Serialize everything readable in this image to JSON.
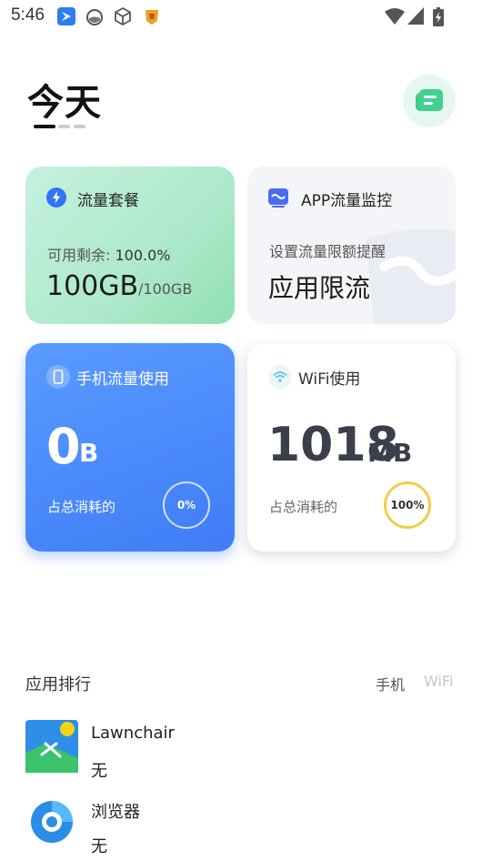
{
  "status_bar": {
    "time": "5:46"
  },
  "header": {
    "title": "今天"
  },
  "cards": {
    "data_plan": {
      "label": "流量套餐",
      "remaining_label": "可用剩余:",
      "remaining_value": "100.0%",
      "amount": "100GB",
      "total": "/100GB"
    },
    "app_monitor": {
      "label": "APP流量监控",
      "subtitle": "设置流量限额提醒",
      "action": "应用限流"
    },
    "mobile_usage": {
      "label": "手机流量使用",
      "amount_value": "0",
      "amount_unit": "B",
      "share_label": "占总消耗的",
      "share_percent": "0%"
    },
    "wifi_usage": {
      "label": "WiFi使用",
      "amount_value": "1018",
      "amount_unit": "MB",
      "share_label": "占总消耗的",
      "share_percent": "100%"
    }
  },
  "ranking": {
    "title": "应用排行",
    "tabs": [
      "手机",
      "WiFi"
    ],
    "active_tab": "手机",
    "apps": [
      {
        "name": "Lawnchair",
        "usage": "无",
        "icon": "lawnchair-icon"
      },
      {
        "name": "浏览器",
        "usage": "无",
        "icon": "browser-icon"
      }
    ]
  },
  "colors": {
    "green_card": "#aee9ca",
    "blue_card": "#3f7cf7",
    "ring_yellow": "#f2cc4b",
    "accent_blue": "#4b6cf2"
  }
}
